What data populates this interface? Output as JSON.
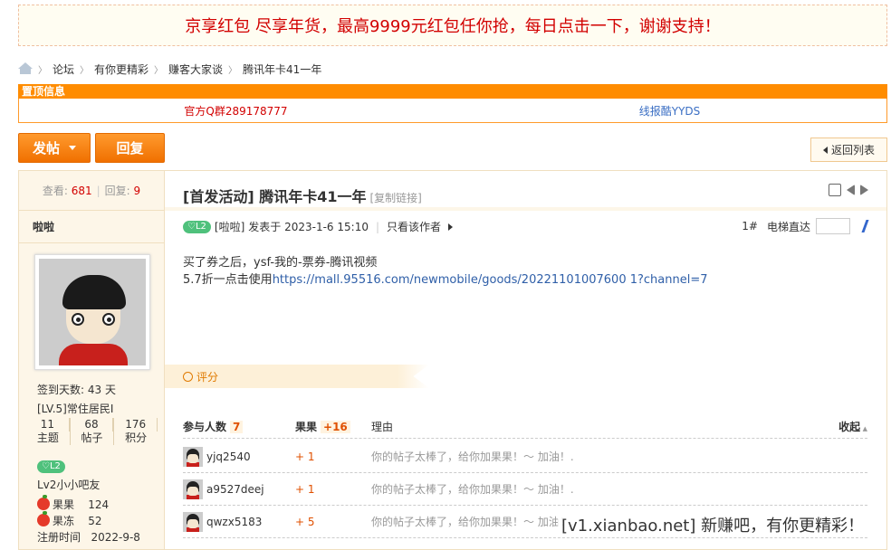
{
  "banner": "京享红包 尽享年货，最高9999元红包任你抢，每日点击一下，谢谢支持！",
  "breadcrumb": [
    "论坛",
    "有你更精彩",
    "赚客大家谈",
    "腾讯年卡41一年"
  ],
  "notice": {
    "header": "置顶信息",
    "items": [
      "官方Q群289178777",
      "线报酷YYDS"
    ]
  },
  "toolbar": {
    "post": "发帖",
    "reply": "回复",
    "back": "返回列表"
  },
  "sidebar": {
    "views_label": "查看:",
    "views": "681",
    "replies_label": "回复:",
    "replies": "9",
    "username": "啦啦",
    "checkin": "签到天数: 43 天",
    "rank": "[LV.5]常住居民I",
    "stats": [
      {
        "value": "11",
        "label": "主题"
      },
      {
        "value": "68",
        "label": "帖子"
      },
      {
        "value": "176",
        "label": "积分"
      }
    ],
    "level_badge": "L2",
    "level_name": "Lv2小小吧友",
    "fruit": [
      {
        "label": "果果",
        "value": "124"
      },
      {
        "label": "果冻",
        "value": "52"
      }
    ],
    "reg_label": "注册时间",
    "reg_date": "2022-9-8"
  },
  "post": {
    "title": "[首发活动] 腾讯年卡41一年",
    "copy_link": "[复制链接]",
    "level_badge": "L2",
    "author": "[啦啦]",
    "posted": "发表于 2023-1-6 15:10",
    "only_author": "只看该作者",
    "floor": "1#",
    "jump_label": "电梯直达",
    "content_line1": "买了券之后，ysf-我的-票券-腾讯视频",
    "content_line2_prefix": "5.7折一点击使用",
    "content_link": "https://mall.95516.com/newmobile/goods/20221101007600 1?channel=7"
  },
  "rating": {
    "label": "评分",
    "head_participants": "参与人数",
    "participants": "7",
    "head_fruit": "果果",
    "fruit_total": "+16",
    "head_reason": "理由",
    "collapse": "收起",
    "rows": [
      {
        "user": "yjq2540",
        "score": "+ 1",
        "reason": "你的帖子太棒了，给你加果果！～ 加油！."
      },
      {
        "user": "a9527deej",
        "score": "+ 1",
        "reason": "你的帖子太棒了，给你加果果！～ 加油！."
      },
      {
        "user": "qwzx5183",
        "score": "+ 5",
        "reason": "你的帖子太棒了，给你加果果！～ 加油！."
      }
    ]
  },
  "watermark": "[v1.xianbao.net] 新赚吧，有你更精彩！"
}
